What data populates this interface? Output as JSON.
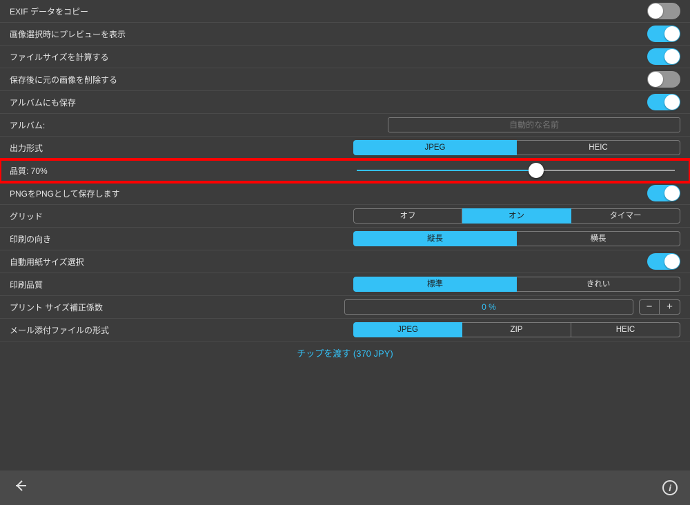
{
  "rows": {
    "copy_exif": "EXIF データをコピー",
    "preview_on_select": "画像選択時にプレビューを表示",
    "calc_filesize": "ファイルサイズを計算する",
    "delete_original": "保存後に元の画像を削除する",
    "save_to_album": "アルバムにも保存",
    "album_label": "アルバム:",
    "album_placeholder": "自動的な名前",
    "output_format": "出力形式",
    "format_jpeg": "JPEG",
    "format_heic": "HEIC",
    "quality": "品質: 70%",
    "save_png_as_png": "PNGをPNGとして保存します",
    "grid": "グリッド",
    "grid_off": "オフ",
    "grid_on": "オン",
    "grid_timer": "タイマー",
    "print_orientation": "印刷の向き",
    "orient_v": "縦長",
    "orient_h": "横長",
    "auto_paper": "自動用紙サイズ選択",
    "print_quality": "印刷品質",
    "pq_standard": "標準",
    "pq_fine": "きれい",
    "print_size_corr": "プリント サイズ補正係数",
    "print_size_val": "0 %",
    "stepper_minus": "−",
    "stepper_plus": "+",
    "mail_format": "メール添付ファイルの形式",
    "mail_jpeg": "JPEG",
    "mail_zip": "ZIP",
    "mail_heic": "HEIC",
    "tip_link": "チップを渡す (370 JPY)"
  },
  "slider": {
    "fill_percent": 56
  },
  "colors": {
    "accent": "#34c1f6",
    "highlight": "#ff0000"
  }
}
